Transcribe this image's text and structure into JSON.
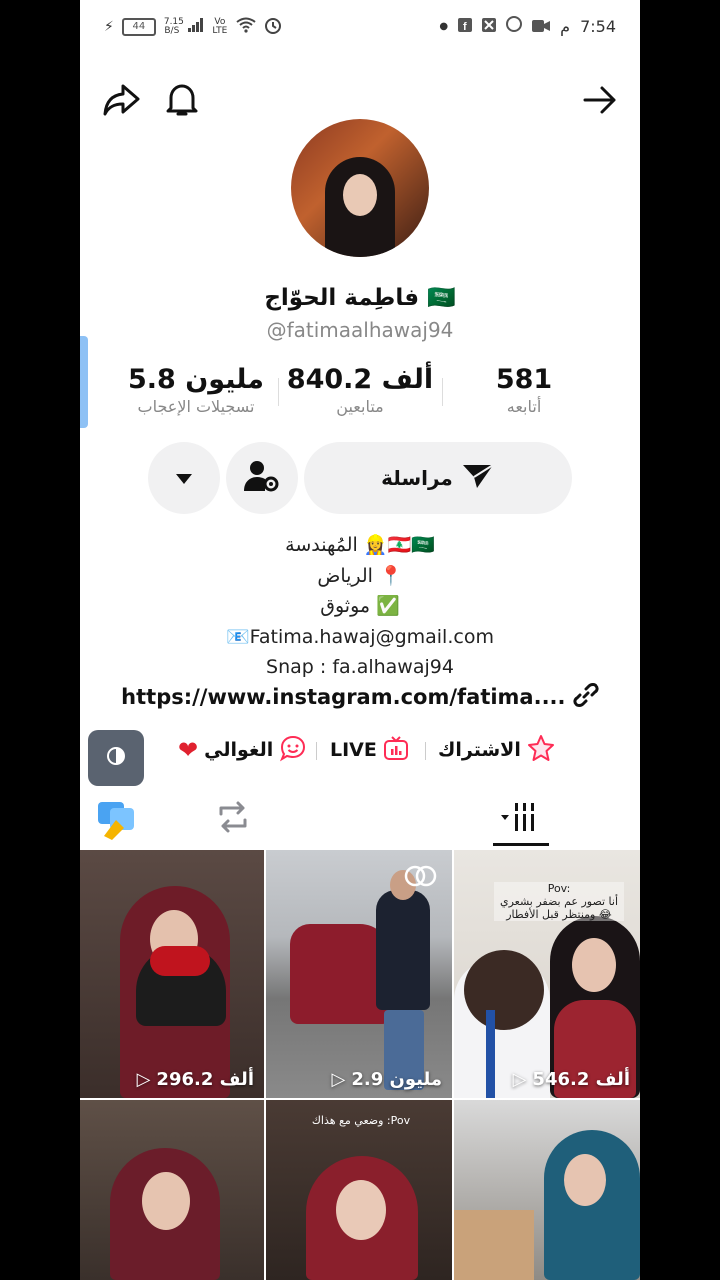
{
  "status_bar": {
    "time": "7:54",
    "ampm": "م",
    "battery": "44",
    "data_speed": "7.15",
    "data_unit": "B/S",
    "volte": "Vo LTE"
  },
  "profile": {
    "name": "فاطِمة الحوّاج",
    "flag": "🇸🇦",
    "handle": "@fatimaalhawaj94"
  },
  "stats": [
    {
      "value": "581",
      "label": "أتابعه"
    },
    {
      "value": "840.2 ألف",
      "label": "متابعين"
    },
    {
      "value": "5.8 مليون",
      "label": "تسجيلات الإعجاب"
    }
  ],
  "actions": {
    "message_label": "مراسلة"
  },
  "bio": [
    "المُهندسة 👷‍♀️🇱🇧🇸🇦",
    "الرياض 📍",
    "موثوق ✅",
    "📧Fatima.hawaj@gmail.com",
    "Snap : fa.alhawaj94"
  ],
  "link": "https://www.instagram.com/fatima....",
  "chips": [
    {
      "label": "الاشتراك",
      "icon": "star-icon"
    },
    {
      "label": "LIVE",
      "icon": "tv-icon"
    },
    {
      "label": "الغوالي",
      "icon": "heart-icon"
    }
  ],
  "videos": [
    {
      "views": "296.2 ألف"
    },
    {
      "views": "2.9 مليون"
    },
    {
      "views": "546.2 ألف",
      "overlay_title": "Pov:",
      "overlay_text": "أنا تصور عم بضفر بشعري ومنتظر قبل الأفطار 😂"
    },
    {
      "views": ""
    },
    {
      "views": "",
      "overlay_text": "وضعي مع هذاك :Pov"
    },
    {
      "views": ""
    }
  ],
  "colors": {
    "accent_red": "#fe2c55",
    "heart": "#e0212f",
    "bubble_bg": "#f1f1f2"
  }
}
